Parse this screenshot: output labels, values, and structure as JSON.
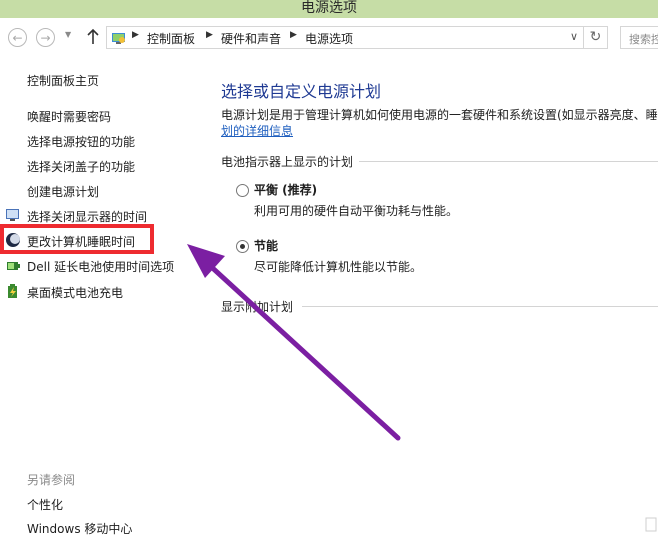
{
  "window": {
    "title": "电源选项"
  },
  "navbar": {
    "breadcrumbs": [
      "控制面板",
      "硬件和声音",
      "电源选项"
    ],
    "search_placeholder": "搜索控"
  },
  "sidebar": {
    "home": "控制面板主页",
    "items": [
      {
        "label": "唤醒时需要密码"
      },
      {
        "label": "选择电源按钮的功能"
      },
      {
        "label": "选择关闭盖子的功能"
      },
      {
        "label": "创建电源计划"
      },
      {
        "label": "选择关闭显示器的时间",
        "icon": "monitor-power-icon"
      },
      {
        "label": "更改计算机睡眠时间",
        "icon": "moon-sleep-icon"
      },
      {
        "label": "Dell 延长电池使用时间选项",
        "icon": "dell-battery-icon"
      },
      {
        "label": "桌面模式电池充电",
        "icon": "battery-charge-icon"
      }
    ],
    "see_also_title": "另请参阅",
    "see_also": [
      "个性化",
      "Windows 移动中心"
    ]
  },
  "main": {
    "title": "选择或自定义电源计划",
    "description": "电源计划是用于管理计算机如何使用电源的一套硬件和系统设置(如显示器亮度、睡",
    "description_link": "划的详细信息",
    "group_label": "电池指示器上显示的计划",
    "plans": [
      {
        "name": "平衡 (推荐)",
        "desc": "利用可用的硬件自动平衡功耗与性能。",
        "selected": false
      },
      {
        "name": "节能",
        "desc": "尽可能降低计算机性能以节能。",
        "selected": true
      }
    ],
    "more_plans": "显示附加计划"
  },
  "annotation": {
    "highlight_color": "#ee2b30",
    "arrow_color": "#7b1fa2"
  }
}
